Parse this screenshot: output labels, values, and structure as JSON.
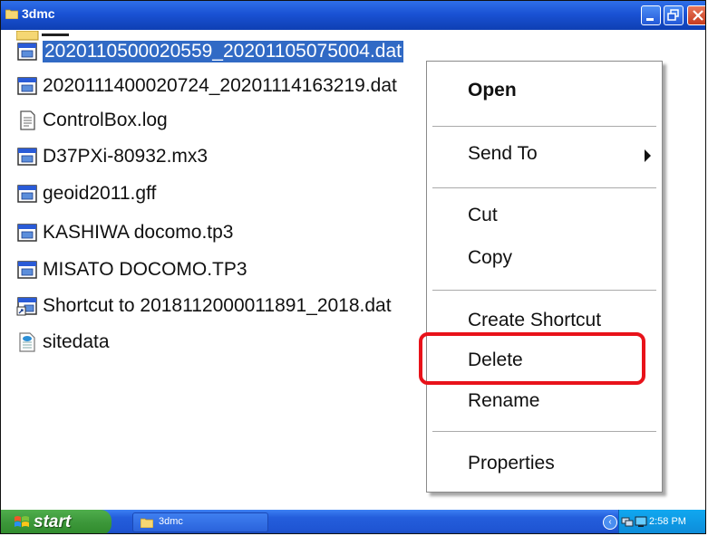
{
  "window": {
    "title": "3dmc"
  },
  "files": [
    {
      "name": "2020110500020559_20201105075004.dat",
      "icon": "data-file-icon",
      "selected": true
    },
    {
      "name": "2020111400020724_20201114163219.dat",
      "icon": "data-file-icon"
    },
    {
      "name": "ControlBox.log",
      "icon": "text-file-icon"
    },
    {
      "name": "D37PXi-80932.mx3",
      "icon": "data-file-icon"
    },
    {
      "name": "geoid2011.gff",
      "icon": "data-file-icon"
    },
    {
      "name": "KASHIWA docomo.tp3",
      "icon": "data-file-icon"
    },
    {
      "name": "MISATO DOCOMO.TP3",
      "icon": "data-file-icon"
    },
    {
      "name": "Shortcut to 2018112000011891_2018.dat",
      "icon": "shortcut-icon"
    },
    {
      "name": "sitedata",
      "icon": "xml-file-icon"
    }
  ],
  "context_menu": {
    "open": "Open",
    "send_to": "Send To",
    "cut": "Cut",
    "copy": "Copy",
    "create_shortcut": "Create Shortcut",
    "delete": "Delete",
    "rename": "Rename",
    "properties": "Properties"
  },
  "taskbar": {
    "start_label": "start",
    "window_button": "3dmc",
    "clock": "2:58 PM"
  },
  "colors": {
    "selection": "#316ac5",
    "highlight_box": "#e8121a",
    "titlebar": "#1a52d4",
    "start_button": "#3c973a"
  }
}
